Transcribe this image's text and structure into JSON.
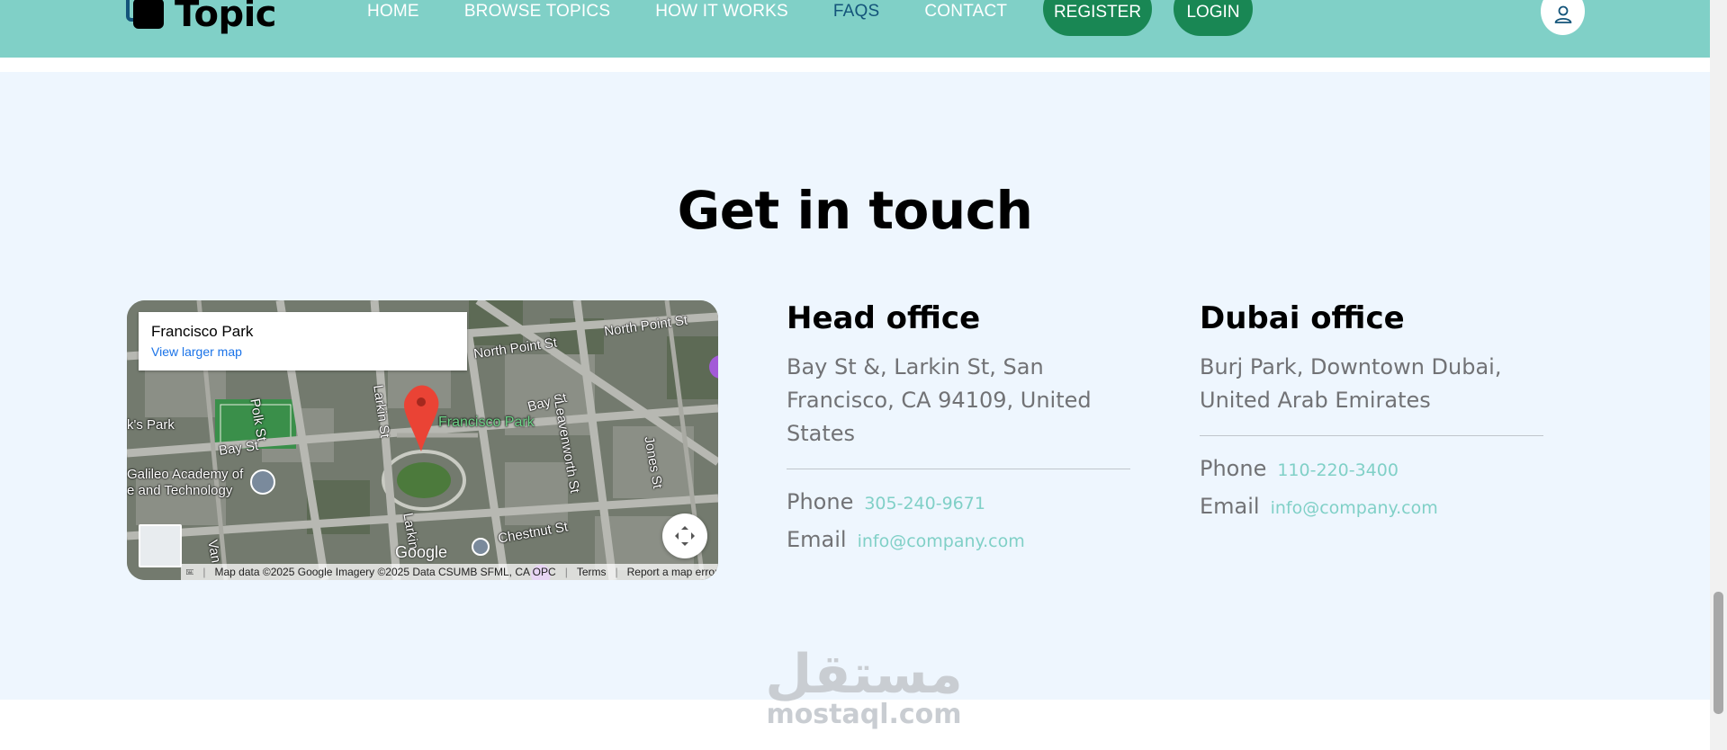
{
  "navbar": {
    "brand": "Topic",
    "links": [
      "HOME",
      "BROWSE TOPICS",
      "HOW IT WORKS",
      "FAQS",
      "CONTACT"
    ],
    "register_label": "REGISTER",
    "login_label": "LOGIN",
    "active_link": "FAQS",
    "user_icon": "user-icon"
  },
  "section": {
    "title": "Get in touch"
  },
  "map": {
    "place_name": "Francisco Park",
    "larger_map_link": "View larger map",
    "pin_label": "Francisco Park",
    "street_labels": [
      "North Point St",
      "North Point St",
      "Bay St",
      "Bay St",
      "Polk St",
      "Larkin St",
      "Leavenworth St",
      "Jones St",
      "Chestnut St",
      "Larkin",
      "Van",
      "k's Park",
      "Galileo Academy of",
      "e and Technology"
    ],
    "google_logo": "Google",
    "attribution": "Map data ©2025 Google Imagery ©2025 Data CSUMB SFML, CA OPC",
    "terms": "Terms",
    "report": "Report a map error"
  },
  "head_office": {
    "title": "Head office",
    "address": "Bay St &, Larkin St, San Francisco, CA 94109, United States",
    "phone_label": "Phone",
    "phone": "305-240-9671",
    "email_label": "Email",
    "email": "info@company.com"
  },
  "dubai_office": {
    "title": "Dubai office",
    "address": "Burj Park, Downtown Dubai, United Arab Emirates",
    "phone_label": "Phone",
    "phone": "110-220-3400",
    "email_label": "Email",
    "email": "info@company.com"
  },
  "watermark": {
    "arabic": "مستقل",
    "latin": "mostaql.com"
  },
  "colors": {
    "navbar": "#80d0c7",
    "button": "#198754",
    "active_link": "#13547a",
    "section_bg": "#eef6fe",
    "link_teal": "#80d0c7",
    "text_gray": "#717275"
  }
}
